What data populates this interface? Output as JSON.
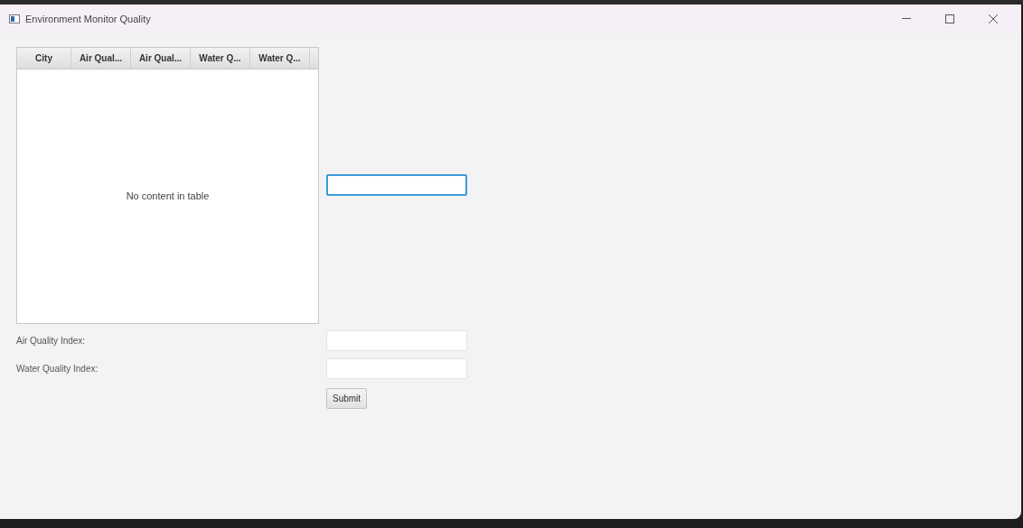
{
  "window": {
    "title": "Environment Monitor Quality"
  },
  "table": {
    "columns": [
      "City",
      "Air Qual...",
      "Air Qual...",
      "Water Q...",
      "Water Q..."
    ],
    "empty_message": "No content in table"
  },
  "city_field": {
    "focused": true
  },
  "form": {
    "rows": [
      {
        "label": "Air Quality Index:",
        "focused": false
      },
      {
        "label": "Water Quality Index:",
        "focused": false
      }
    ],
    "submit": "Submit"
  }
}
